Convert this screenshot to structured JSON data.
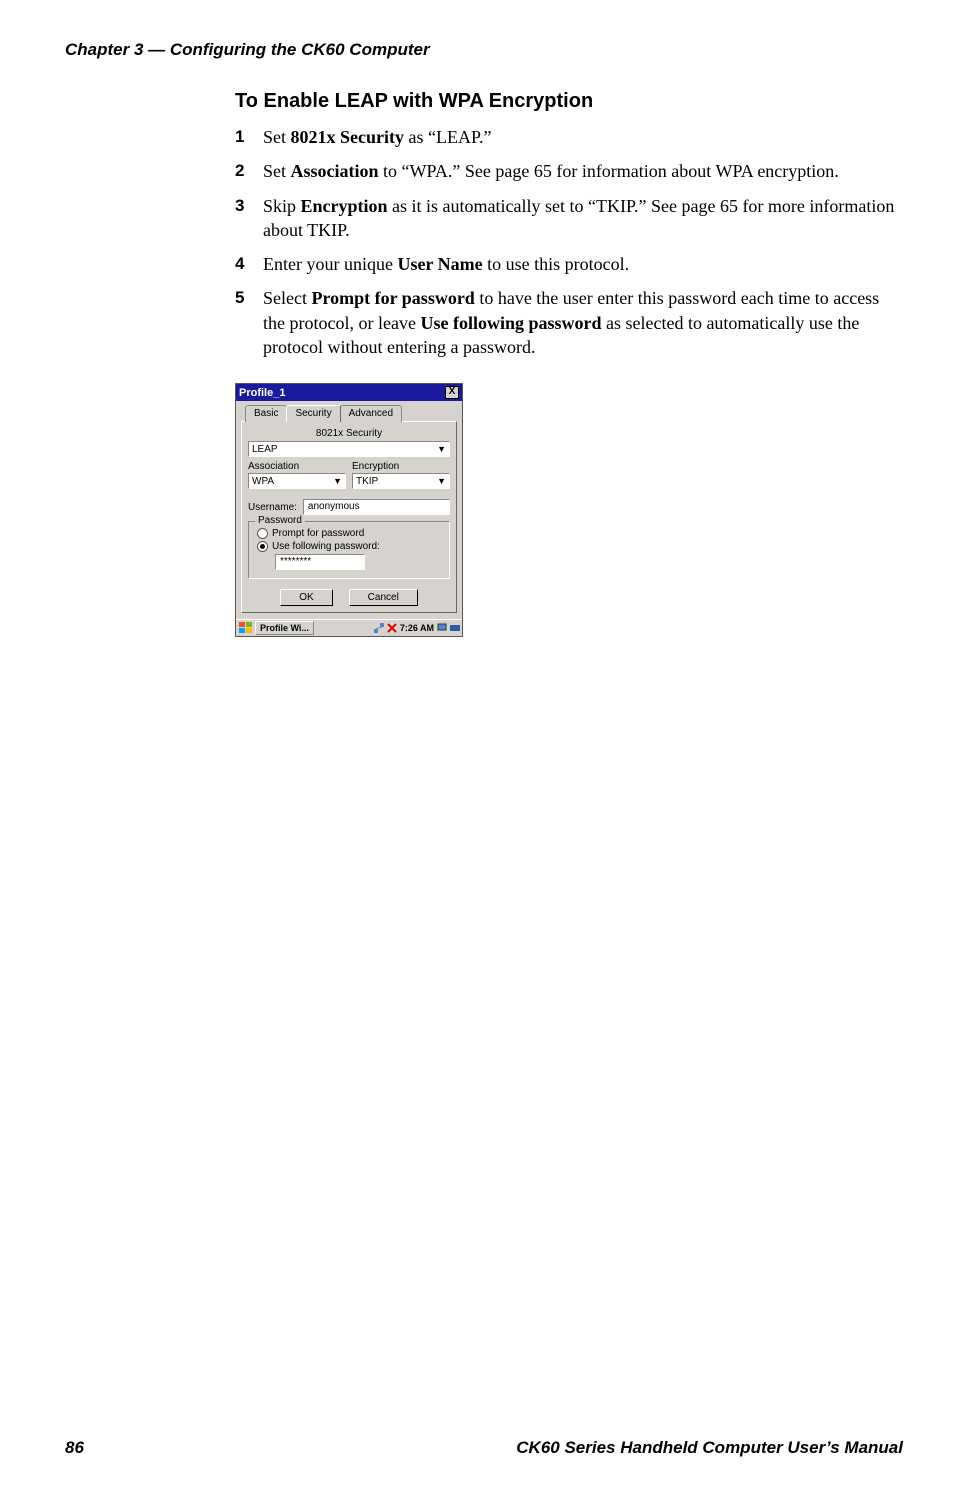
{
  "header": {
    "chapter": "Chapter 3 — Configuring the CK60 Computer"
  },
  "section": {
    "title": "To Enable LEAP with WPA Encryption"
  },
  "steps": {
    "s1": {
      "pre": "Set ",
      "b1": "8021x Security",
      "post": " as “LEAP.”"
    },
    "s2": {
      "pre": "Set ",
      "b1": "Association",
      "post": " to “WPA.” See page 65 for information about WPA encryption."
    },
    "s3": {
      "pre": "Skip ",
      "b1": "Encryption",
      "post": " as it is automatically set to “TKIP.” See page 65 for more information about TKIP."
    },
    "s4": {
      "pre": "Enter your unique ",
      "b1": "User Name",
      "post": " to use this protocol."
    },
    "s5": {
      "pre": "Select ",
      "b1": "Prompt for password",
      "mid": " to have the user enter this password each time to access the protocol, or leave ",
      "b2": "Use following password",
      "post": " as selected to automatically use the protocol without entering a password."
    }
  },
  "window": {
    "title": "Profile_1",
    "close": "X",
    "tabs": {
      "basic": "Basic",
      "security": "Security",
      "advanced": "Advanced"
    },
    "sec_label": "8021x Security",
    "sec_value": "LEAP",
    "assoc_label": "Association",
    "assoc_value": "WPA",
    "enc_label": "Encryption",
    "enc_value": "TKIP",
    "user_label": "Username:",
    "user_value": "anonymous",
    "group_title": "Password",
    "radio1": "Prompt for password",
    "radio2": "Use following password:",
    "pw_value": "********",
    "ok": "OK",
    "cancel": "Cancel",
    "task_app": "Profile Wi...",
    "task_time": "7:26 AM"
  },
  "footer": {
    "page": "86",
    "manual": "CK60 Series Handheld Computer User’s Manual"
  }
}
